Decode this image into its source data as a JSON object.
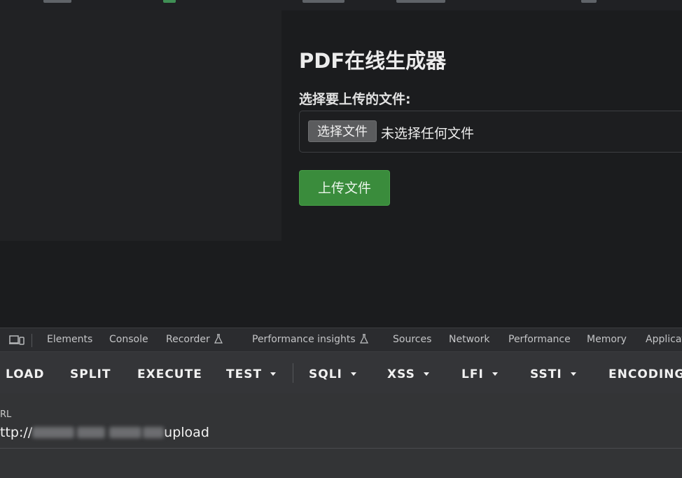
{
  "page": {
    "title": "PDF在线生成器",
    "file_label": "选择要上传的文件:",
    "choose_button": "选择文件",
    "no_file_text": "未选择任何文件",
    "upload_button": "上传文件"
  },
  "devtools": {
    "tabs": [
      "Elements",
      "Console",
      "Recorder",
      "Performance insights",
      "Sources",
      "Network",
      "Performance",
      "Memory",
      "Applicat"
    ]
  },
  "hackbar": {
    "buttons": [
      "LOAD",
      "SPLIT",
      "EXECUTE",
      "TEST",
      "SQLI",
      "XSS",
      "LFI",
      "SSTI",
      "ENCODING"
    ],
    "url_label": "RL",
    "url_prefix": "ttp://",
    "url_suffix": "upload"
  },
  "colors": {
    "upload_button": "#3a8c3c",
    "page_bg": "#1b1c1e",
    "devtools_bg": "#2b2c2f",
    "hackbar_bg": "#343538"
  },
  "icons": {
    "device_toggle": "device-toolbar-icon",
    "experiment": "flask-icon",
    "dropdown": "chevron-down-icon"
  }
}
